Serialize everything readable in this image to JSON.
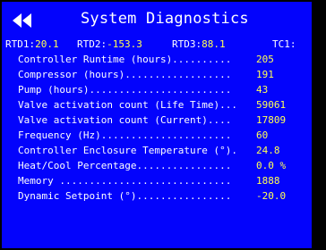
{
  "header": {
    "title": "System Diagnostics",
    "back_icon": "double-chevron-left-icon"
  },
  "rtd": [
    {
      "label": "RTD1:",
      "value": "20.1"
    },
    {
      "label": "RTD2:",
      "value": "-153.3"
    },
    {
      "label": "RTD3:",
      "value": "88.1"
    },
    {
      "label": "TC1:",
      "value": ""
    }
  ],
  "rows": [
    {
      "label": "Controller Runtime (hours)..........",
      "value": "205"
    },
    {
      "label": "Compressor (hours)..................",
      "value": "191"
    },
    {
      "label": "Pump (hours)........................",
      "value": "43"
    },
    {
      "label": "Valve activation count (Life Time)...",
      "value": "59061"
    },
    {
      "label": "Valve activation count (Current)....",
      "value": "17809"
    },
    {
      "label": "Frequency (Hz)......................",
      "value": "60"
    },
    {
      "label": "Controller Enclosure Temperature (°).",
      "value": "24.8"
    },
    {
      "label": "Heat/Cool Percentage................",
      "value": "0.0 %"
    },
    {
      "label": "Memory .............................",
      "value": "1888"
    },
    {
      "label": "Dynamic Setpoint (°)................",
      "value": "-20.0"
    }
  ],
  "colors": {
    "background": "#0303fc",
    "label": "#ffffff",
    "value": "#ffff55",
    "bezel": "#000000"
  }
}
